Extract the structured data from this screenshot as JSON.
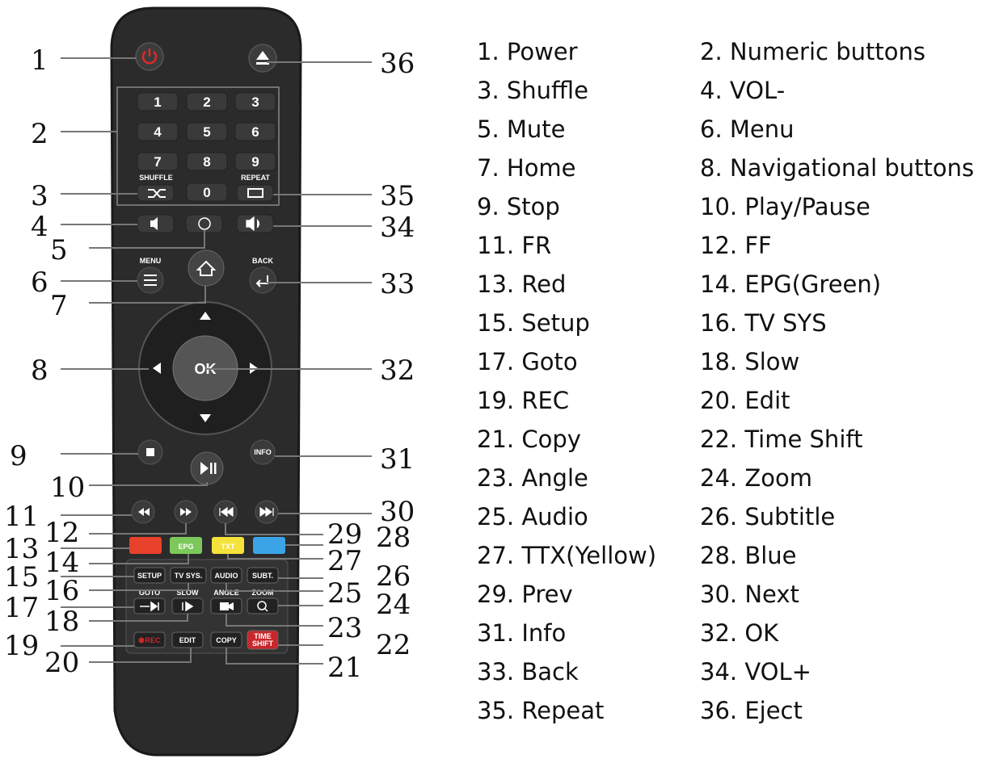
{
  "remote": {
    "numeric_keys": [
      "1",
      "2",
      "3",
      "4",
      "5",
      "6",
      "7",
      "8",
      "9",
      "0"
    ],
    "shuffle_label": "SHUFFLE",
    "repeat_label": "REPEAT",
    "menu_label": "MENU",
    "back_label": "BACK",
    "ok_label": "OK",
    "info_label": "INFO",
    "epg_label": "EPG",
    "txt_label": "TXT",
    "setup_label": "SETUP",
    "tvsys_label": "TV SYS.",
    "audio_label": "AUDIO",
    "subt_label": "SUBT.",
    "goto_label": "GOTO",
    "slow_label": "SLOW",
    "angle_label": "ANGLE",
    "zoom_label": "ZOOM",
    "rec_label": "REC",
    "edit_label": "EDIT",
    "copy_label": "COPY",
    "timeshift_label_1": "TIME",
    "timeshift_label_2": "SHIFT"
  },
  "callouts": {
    "left": [
      "1",
      "2",
      "3",
      "4",
      "5",
      "6",
      "7",
      "8",
      "9",
      "10",
      "11",
      "12",
      "13",
      "14",
      "15",
      "16",
      "17",
      "18",
      "19",
      "20"
    ],
    "right": [
      "36",
      "35",
      "34",
      "33",
      "32",
      "31",
      "30",
      "29",
      "28",
      "27",
      "26",
      "25",
      "24",
      "23",
      "22",
      "21"
    ]
  },
  "legend": [
    "1. Power",
    "2. Numeric buttons",
    "3. Shuffle",
    "4. VOL-",
    "5. Mute",
    "6. Menu",
    "7. Home",
    "8. Navigational buttons",
    "9. Stop",
    "10. Play/Pause",
    "11. FR",
    "12. FF",
    "13. Red",
    "14. EPG(Green)",
    "15. Setup",
    "16. TV SYS",
    "17. Goto",
    "18. Slow",
    "19. REC",
    "20. Edit",
    "21. Copy",
    "22. Time Shift",
    "23. Angle",
    "24. Zoom",
    "25. Audio",
    "26. Subtitle",
    "27. TTX(Yellow)",
    "28. Blue",
    "29. Prev",
    "30. Next",
    "31. Info",
    "32. OK",
    "33. Back",
    "34. VOL+",
    "35. Repeat",
    "36. Eject"
  ],
  "colors": {
    "body": "#2b2b2b",
    "button": "#3a3a3a",
    "red_key": "#e8412c",
    "green_key": "#7cc85a",
    "yellow_key": "#f5e23a",
    "blue_key": "#3aa4e6",
    "power_icon": "#e0282a",
    "rec_key": "#c8272d"
  }
}
